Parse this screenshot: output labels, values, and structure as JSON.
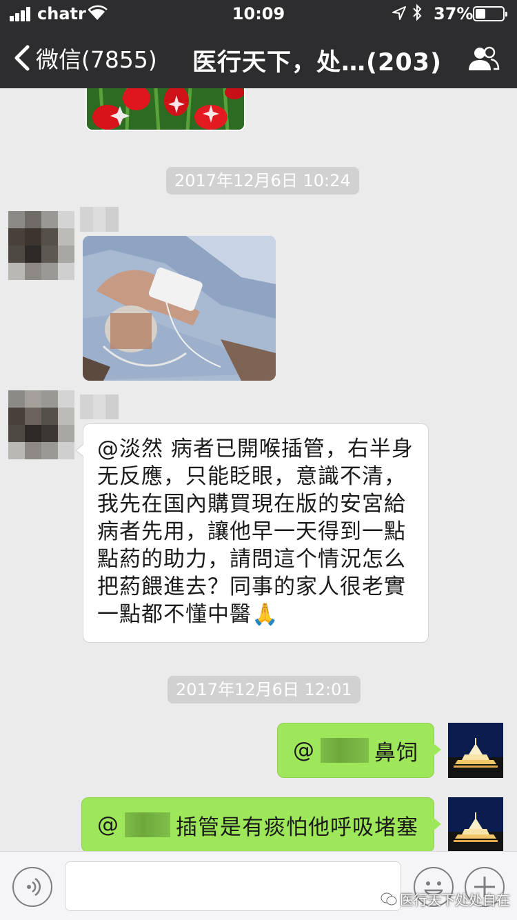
{
  "status_bar": {
    "carrier": "chatr",
    "time": "10:09",
    "battery_text": "37%",
    "battery_level": 0.37
  },
  "nav": {
    "back_label": "微信(7855)",
    "title": "医行天下，处…(203)"
  },
  "messages": {
    "time1": "2017年12月6日 10:24",
    "msg1_text": "@淡然 病者已開喉插管，右半身\n无反應，只能眨眼，意識不清，\n我先在国內購買現在版的安宮給\n病者先用，讓他早一天得到一點\n點葯的助力，請問這个情況怎么\n把葯餵進去？同事的家人很老實\n一點都不懂中醫🙏",
    "time2": "2017年12月6日 12:01",
    "reply1_at": "@",
    "reply1_text": "鼻饲",
    "reply2_at": "@",
    "reply2_text": "插管是有痰怕他呼吸堵塞"
  },
  "watermark": "医行天下处处自在",
  "colors": {
    "nav_bg": "#2d2d2f",
    "chat_bg": "#ebebeb",
    "outgoing_bubble": "#9fe75a",
    "timestamp_bg": "#d1d1d1"
  },
  "icons": {
    "back": "chevron-left-icon",
    "members": "group-icon",
    "voice": "voice-icon",
    "emoji": "emoji-icon",
    "add": "plus-icon"
  }
}
